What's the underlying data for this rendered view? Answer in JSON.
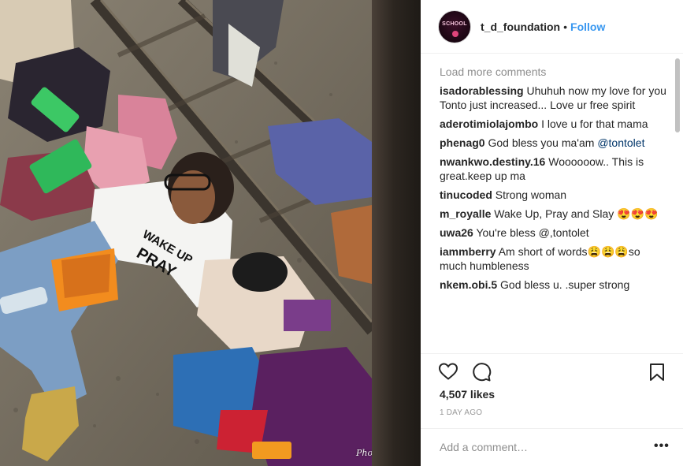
{
  "post": {
    "username": "t_d_foundation",
    "separator": "•",
    "follow_label": "Follow",
    "avatar_text": "SCHOOL",
    "photo_watermark": "PhotoGrid",
    "shirt_text_1": "WAKE UP",
    "shirt_text_2": "PRAY"
  },
  "comments": {
    "load_more_label": "Load more comments",
    "items": [
      {
        "user": "isadorablessing",
        "text": "Uhuhuh now my love for you Tonto just increased... Love ur free spirit"
      },
      {
        "user": "aderotimiolajombo",
        "text": "I love u for that mama"
      },
      {
        "user": "phenag0",
        "text": "God bless you ma'am",
        "mention": "@tontolet"
      },
      {
        "user": "nwankwo.destiny.16",
        "text": "Woooooow.. This is great.keep up ma"
      },
      {
        "user": "tinucoded",
        "text": "Strong woman"
      },
      {
        "user": "m_royalle",
        "text": "Wake Up, Pray and Slay 😍😍😍"
      },
      {
        "user": "uwa26",
        "text": "You're bless @,tontolet"
      },
      {
        "user": "iammberry",
        "text": "Am short of words😩😩😩so much humbleness"
      },
      {
        "user": "nkem.obi.5",
        "text": "God bless u. .super strong"
      }
    ]
  },
  "stats": {
    "likes": "4,507 likes",
    "date": "1 DAY AGO"
  },
  "compose": {
    "placeholder": "Add a comment…",
    "more_label": "•••"
  },
  "icons": {
    "like": "heart-icon",
    "comment": "comment-bubble-icon",
    "save": "bookmark-icon",
    "more": "more-options-icon"
  },
  "colors": {
    "follow": "#3897f0",
    "text": "#262626",
    "muted": "#8e8e8e"
  }
}
